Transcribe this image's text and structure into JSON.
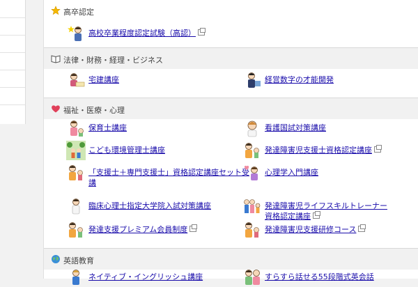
{
  "sections": {
    "highschool": {
      "title": "高卒認定",
      "items": [
        {
          "label": "高校卒業程度認定試験（高認）"
        }
      ]
    },
    "law": {
      "title": "法律・財務・経理・ビジネス",
      "items": [
        {
          "label": "宅建講座"
        },
        {
          "label": "経営数字の才能開発"
        }
      ]
    },
    "welfare": {
      "title": "福祉・医療・心理",
      "items": [
        {
          "label": "保育士講座"
        },
        {
          "label": "看護国試対策講座"
        },
        {
          "label": "こども環境管理士講座"
        },
        {
          "label": "発達障害児支援士資格認定講座"
        },
        {
          "label": "「支援士＋専門支援士」資格認定講座セット受",
          "label2": "講"
        },
        {
          "label": "心理学入門講座"
        },
        {
          "label": "臨床心理士指定大学院入試対策講座"
        },
        {
          "label": "発達障害児ライフスキルトレーナー",
          "label2": "資格認定講座"
        },
        {
          "label": "発達支援プレミアム会員制度"
        },
        {
          "label": "発達障害児支援研修コース"
        }
      ]
    },
    "english": {
      "title": "英語教育",
      "items": [
        {
          "label": "ネイティブ・イングリッシュ講座"
        },
        {
          "label": "すらすら話せる55段階式英会話"
        }
      ]
    }
  },
  "icons": {
    "highschool": "star-icon",
    "law": "book-icon",
    "welfare": "heart-icon",
    "english": "globe-icon"
  },
  "colors": {
    "link": "#1a0dab",
    "star": "#f5b800",
    "heart": "#e0405a",
    "globe": "#3a8fd8"
  }
}
